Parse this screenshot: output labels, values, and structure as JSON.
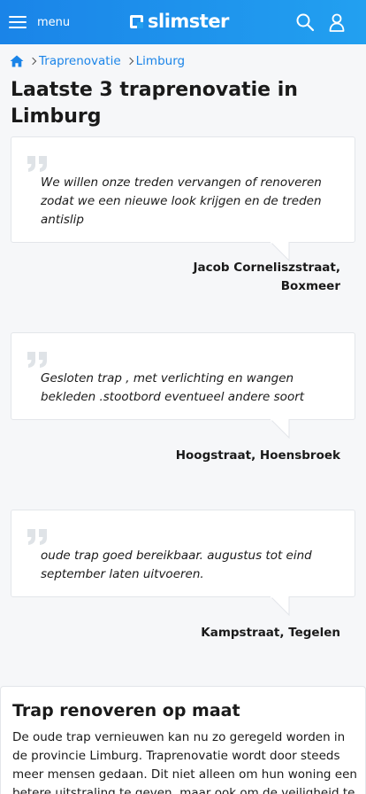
{
  "header": {
    "menu_label": "menu",
    "logo_text": "slimster",
    "icons": [
      "hamburger-icon",
      "slimster-logo-mark",
      "search-icon",
      "user-icon"
    ],
    "colors": {
      "brand_blue": "#1a84e8"
    }
  },
  "breadcrumb": {
    "home_icon": "home-icon",
    "items": [
      "Traprenovatie",
      "Limburg"
    ]
  },
  "page_title": "Laatste 3 traprenovatie in Limburg",
  "testimonials": [
    {
      "quote": "We willen onze treden vervangen of renoveren zodat we een nieuwe look krijgen en de treden antislip",
      "address": "Jacob Corneliszstraat, Boxmeer"
    },
    {
      "quote": "Gesloten trap , met verlichting en wangen bekleden .stootbord eventueel andere soort",
      "address": "Hoogstraat, Hoensbroek"
    },
    {
      "quote": "oude trap goed bereikbaar. augustus tot eind september laten uitvoeren.",
      "address": "Kampstraat, Tegelen"
    }
  ],
  "info": {
    "title": "Trap renoveren op maat",
    "body": "De oude trap vernieuwen kan nu zo geregeld worden in de provincie Limburg. Traprenovatie wordt door steeds meer mensen gedaan. Dit niet alleen om hun woning een betere uitstraling te geven, maar ook om de veiligheid te"
  }
}
